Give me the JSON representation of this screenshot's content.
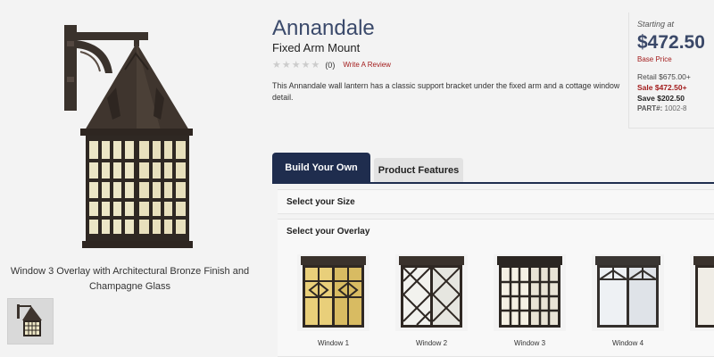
{
  "product": {
    "title": "Annandale",
    "subtitle": "Fixed Arm Mount",
    "rating_count": "(0)",
    "review_link": "Write A Review",
    "description": "This Annandale wall lantern has a classic support bracket under the fixed arm and a cottage window detail."
  },
  "image": {
    "caption": "Window 3 Overlay with Architectural Bronze Finish and Champagne Glass"
  },
  "price": {
    "starting_label": "Starting at",
    "price": "$472.50",
    "base_label": "Base Price",
    "retail": "Retail $675.00+",
    "sale": "Sale $472.50+",
    "save": "Save $202.50",
    "part_label": "PART#:",
    "part_number": "1002-8"
  },
  "tabs": [
    {
      "label": "Build Your Own"
    },
    {
      "label": "Product Features"
    }
  ],
  "sections": {
    "size": "Select your Size",
    "overlay": "Select your Overlay"
  },
  "overlays": [
    {
      "label": "Window 1",
      "glass": "#e9cf7a"
    },
    {
      "label": "Window 2",
      "glass": "#f2f2ee"
    },
    {
      "label": "Window 3",
      "glass": "#f4f0e4"
    },
    {
      "label": "Window 4",
      "glass": "#eef1f4"
    }
  ],
  "colors": {
    "accent": "#1f2d4e",
    "price": "#3a4868",
    "sale": "#a31c1c",
    "bronze": "#3a322c"
  }
}
